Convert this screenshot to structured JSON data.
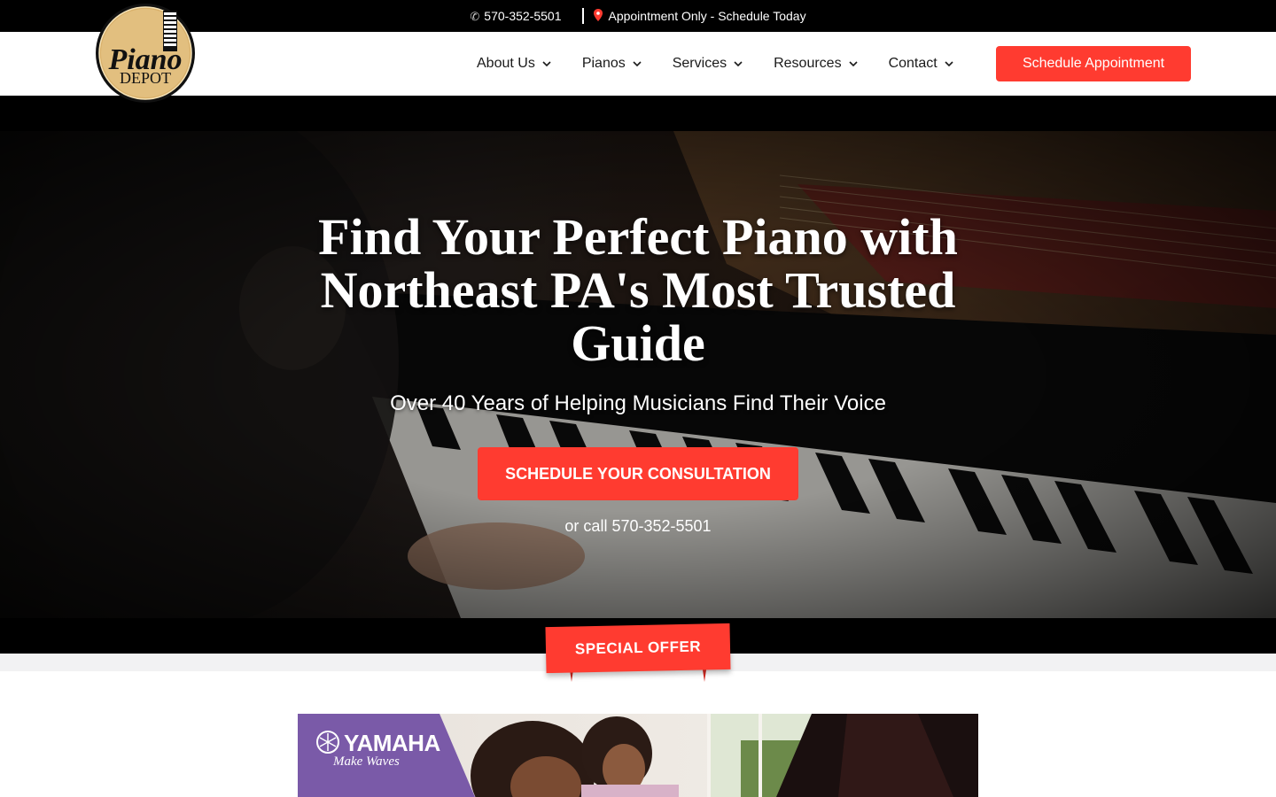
{
  "topbar": {
    "phone": "570-352-5501",
    "appointment": "Appointment Only - Schedule Today",
    "phone_icon": "phone-icon",
    "location_icon": "map-pin-icon"
  },
  "header": {
    "logo_text_1": "Piano",
    "logo_text_2": "DEPOT",
    "nav": [
      {
        "label": "About Us"
      },
      {
        "label": "Pianos"
      },
      {
        "label": "Services"
      },
      {
        "label": "Resources"
      },
      {
        "label": "Contact"
      }
    ],
    "cta": "Schedule Appointment"
  },
  "hero": {
    "title": "Find Your Perfect Piano with Northeast PA's Most Trusted Guide",
    "subtitle": "Over 40 Years of Helping Musicians Find Their Voice",
    "cta": "SCHEDULE YOUR CONSULTATION",
    "call_prefix": "or call",
    "call_number": "570-352-5501"
  },
  "ribbon": {
    "label": "SPECIAL OFFER"
  },
  "promo": {
    "brand": "YAMAHA",
    "tagline": "Make Waves"
  },
  "colors": {
    "accent": "#ff3b30",
    "topbar_bg": "#000000",
    "promo_purple": "#7a5aa8",
    "logo_gold": "#d9b06a"
  }
}
